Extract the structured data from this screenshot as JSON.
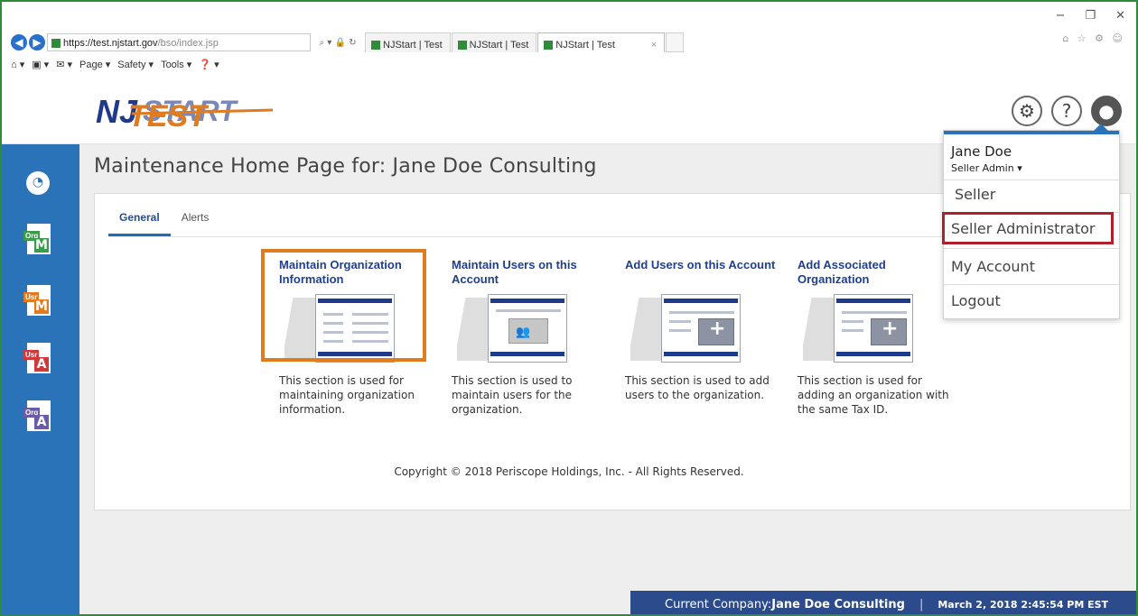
{
  "browser": {
    "url_main": "https://test.njstart.gov",
    "url_path": "/bso/index.jsp",
    "addr_controls": "⌕ ▾ 🔒 ↻",
    "tabs": [
      {
        "label": "NJStart | Test"
      },
      {
        "label": "NJStart | Test"
      },
      {
        "label": "NJStart | Test"
      }
    ],
    "tab_close": "×",
    "command_bar": [
      "Page ▾",
      "Safety ▾",
      "Tools ▾"
    ],
    "window_controls": [
      "−",
      "❐",
      "✕"
    ]
  },
  "header": {
    "logo_text": "NJ",
    "logo_overlay": "TEST",
    "logo_start": "START",
    "settings_icon": "⚙",
    "help_icon": "?",
    "user_icon": "👤"
  },
  "sidebar": {
    "icons": [
      {
        "name": "dashboard-icon"
      },
      {
        "tag": "Org",
        "letter": "M",
        "color": "#3a9b4a"
      },
      {
        "tag": "Usr",
        "letter": "M",
        "color": "#e07b1f"
      },
      {
        "tag": "Usr",
        "letter": "A",
        "color": "#d0393a"
      },
      {
        "tag": "Org",
        "letter": "A",
        "color": "#6b5aa7"
      }
    ]
  },
  "main": {
    "title": "Maintenance Home Page for: Jane Doe Consulting",
    "tabs": [
      {
        "label": "General",
        "active": true
      },
      {
        "label": "Alerts",
        "active": false
      }
    ],
    "tiles": [
      {
        "title": "Maintain Organization Information",
        "desc": "This section is used for maintaining organization information."
      },
      {
        "title": "Maintain Users on this Account",
        "desc": "This section is used to maintain users for the organization."
      },
      {
        "title": "Add Users on this Account",
        "desc": "This section is used to add users to the organization."
      },
      {
        "title": "Add Associated Organization",
        "desc": "This section is used for adding an organization with the same Tax ID."
      }
    ],
    "copyright": "Copyright © 2018 Periscope Holdings, Inc. - All Rights Reserved."
  },
  "user_menu": {
    "name": "Jane Doe",
    "role": "Seller Admin ▾",
    "items": [
      "Seller",
      "Seller Administrator",
      "My Account",
      "Logout"
    ]
  },
  "status_bar": {
    "company_label": "Current Company: ",
    "company": "Jane Doe Consulting",
    "separator": "|",
    "datetime": "March 2, 2018 2:45:54 PM EST"
  },
  "colors": {
    "rail": "#2b73b8",
    "link": "#1f3f8f",
    "highlight_orange": "#e07b1f",
    "highlight_red": "#b0202a",
    "status_bg": "#2b4b8c"
  }
}
